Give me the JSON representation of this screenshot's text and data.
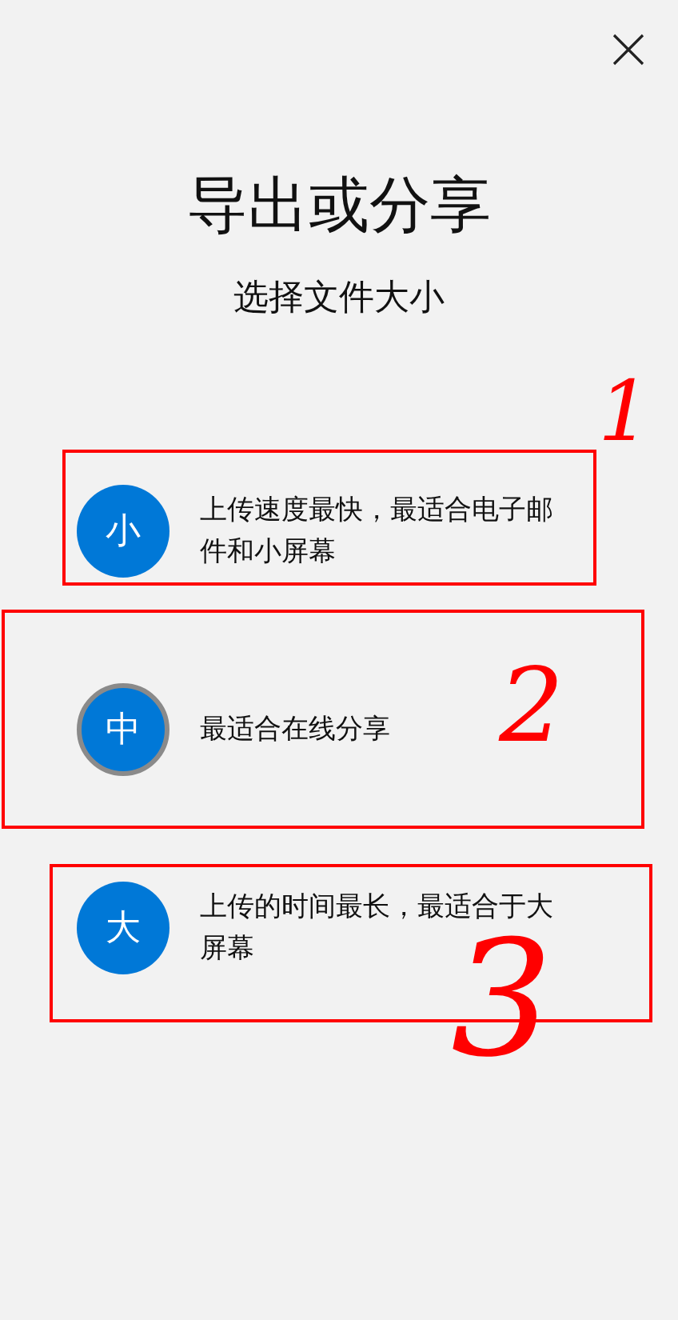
{
  "title": "导出或分享",
  "subtitle": "选择文件大小",
  "options": [
    {
      "badge": "小",
      "description": "上传速度最快，最适合电子邮件和小屏幕",
      "selected": false
    },
    {
      "badge": "中",
      "description": "最适合在线分享",
      "selected": true
    },
    {
      "badge": "大",
      "description": "上传的时间最长，最适合于大屏幕",
      "selected": false
    }
  ],
  "annotations": [
    {
      "label": "1"
    },
    {
      "label": "2"
    },
    {
      "label": "3"
    }
  ]
}
